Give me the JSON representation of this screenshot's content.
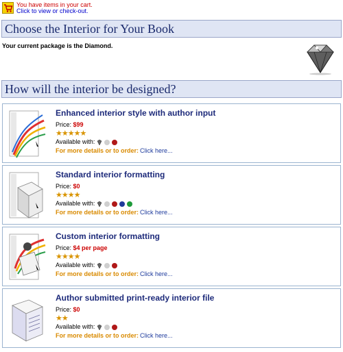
{
  "cart": {
    "line1": "You have items in your cart.",
    "line2": "Click to view or check-out."
  },
  "banners": {
    "choose": "Choose the Interior for Your Book",
    "how": "How will the interior be designed?"
  },
  "package_text": "Your current package is the Diamond.",
  "products": [
    {
      "title": "Enhanced interior style with author input",
      "price_label": "Price:",
      "price": "$99",
      "stars": "★★★★★",
      "available_label": "Available with:",
      "packages": [
        "diamond-icon",
        "silver-icon",
        "ruby-icon"
      ],
      "details_label": "For more details or to order:",
      "link": "Click here..."
    },
    {
      "title": "Standard interior formatting",
      "price_label": "Price:",
      "price": "$0",
      "stars": "★★★★",
      "available_label": "Available with:",
      "packages": [
        "diamond-icon",
        "silver-icon",
        "ruby-icon",
        "sapphire-icon",
        "emerald-icon"
      ],
      "details_label": "For more details or to order:",
      "link": "Click here..."
    },
    {
      "title": "Custom interior formatting",
      "price_label": "Price:",
      "price": "$4 per page",
      "stars": "★★★★",
      "available_label": "Available with:",
      "packages": [
        "diamond-icon",
        "silver-icon",
        "ruby-icon"
      ],
      "details_label": "For more details or to order:",
      "link": "Click here..."
    },
    {
      "title": "Author submitted print-ready interior file",
      "price_label": "Price:",
      "price": "$0",
      "stars": "★★",
      "available_label": "Available with:",
      "packages": [
        "diamond-icon",
        "silver-icon",
        "ruby-icon"
      ],
      "details_label": "For more details or to order:",
      "link": "Click here..."
    }
  ],
  "colors": {
    "banner_bg": "#dfe5f4",
    "title": "#1d2a7a",
    "price": "#cc0000",
    "stars": "#d99400",
    "details": "#d98a00",
    "link": "#1d3a9c"
  }
}
